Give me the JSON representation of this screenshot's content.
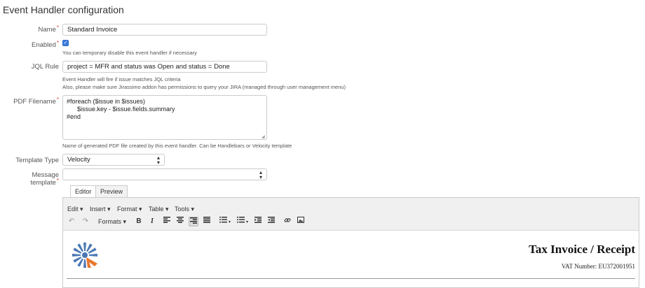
{
  "page": {
    "title": "Event Handler configuration"
  },
  "form": {
    "name": {
      "label": "Name",
      "value": "Standard Invoice"
    },
    "enabled": {
      "label": "Enabled",
      "checked": true,
      "help": "You can temporary disable this event handler if necessary"
    },
    "jql": {
      "label": "JQL Rule",
      "value": "project = MFR and status was Open and status = Done",
      "help1": "Event Handler will fire if issue matches JQL criteria",
      "help2": "Also, please make sure Jirassimo addon has permissions to query your JIRA (managed through user management menu)"
    },
    "pdf_filename": {
      "label": "PDF Filename",
      "value": "#foreach ($issue in $issues)\n      $issue.key - $issue.fields.summary\n#end",
      "help": "Name of generated PDF file created by this event handler. Can be Handlebars or Velocity template"
    },
    "template_type": {
      "label": "Template Type",
      "value": "Velocity"
    },
    "message_template": {
      "label": "Message template",
      "value": ""
    }
  },
  "editor": {
    "tabs": [
      {
        "label": "Editor",
        "active": true
      },
      {
        "label": "Preview",
        "active": false
      }
    ],
    "menus": [
      "Edit ▾",
      "Insert ▾",
      "Format ▾",
      "Table ▾",
      "Tools ▾"
    ],
    "formats_label": "Formats ▾",
    "content": {
      "title": "Tax Invoice / Receipt",
      "vat": "VAT Number: EU372001951"
    }
  },
  "colors": {
    "accent": "#3b7ddd",
    "required": "#d04437",
    "logo_blue": "#4a78b5",
    "logo_orange": "#e8772e"
  }
}
